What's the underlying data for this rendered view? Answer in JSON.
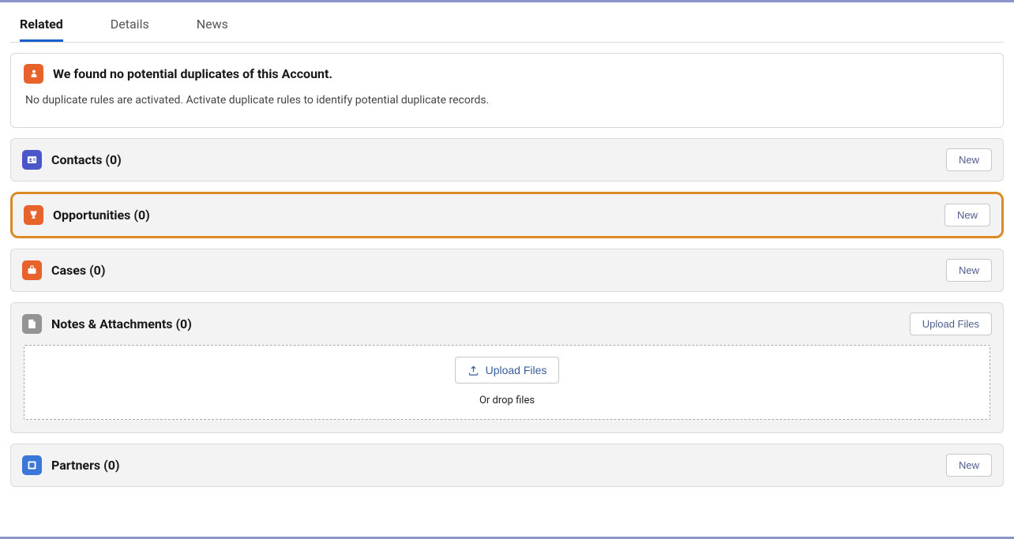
{
  "tabs": {
    "related": "Related",
    "details": "Details",
    "news": "News"
  },
  "duplicates": {
    "title": "We found no potential duplicates of this Account.",
    "subtitle": "No duplicate rules are activated. Activate duplicate rules to identify potential duplicate records."
  },
  "contacts": {
    "title": "Contacts (0)",
    "action": "New"
  },
  "opportunities": {
    "title": "Opportunities (0)",
    "action": "New"
  },
  "cases": {
    "title": "Cases (0)",
    "action": "New"
  },
  "notes": {
    "title": "Notes & Attachments (0)",
    "action": "Upload Files",
    "uploadBtn": "Upload Files",
    "dropText": "Or drop files"
  },
  "partners": {
    "title": "Partners (0)",
    "action": "New"
  }
}
